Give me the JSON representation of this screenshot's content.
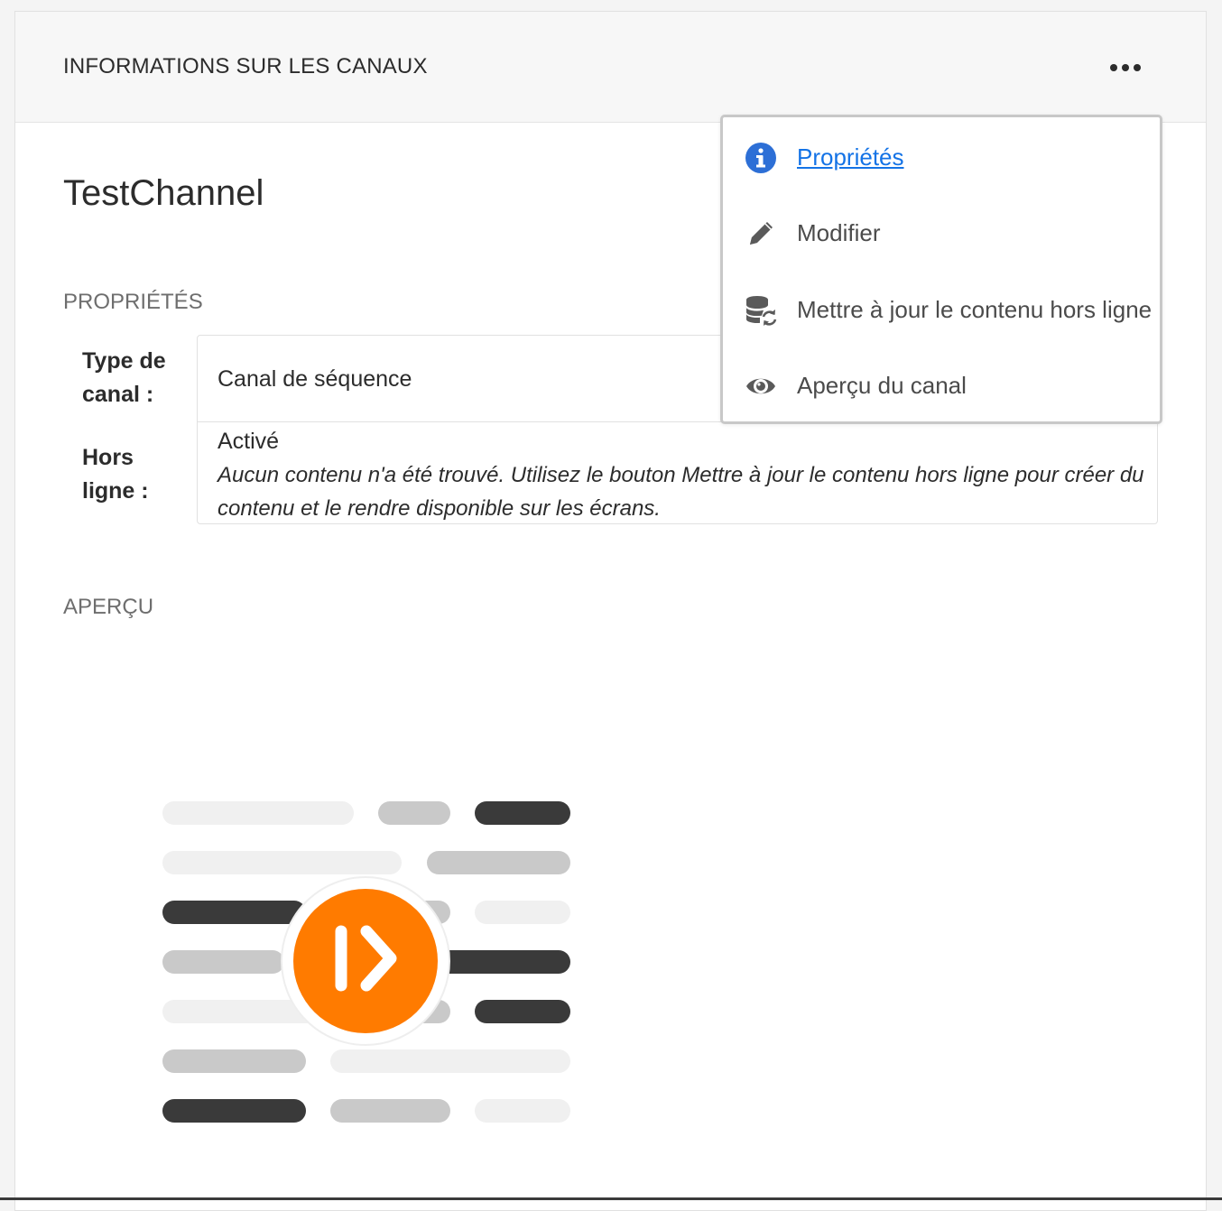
{
  "header": {
    "title": "INFORMATIONS SUR LES CANAUX",
    "more_icon": "more-horizontal-icon"
  },
  "channel": {
    "name": "TestChannel"
  },
  "sections": {
    "properties": "PROPRIÉTÉS",
    "preview": "APERÇU"
  },
  "properties": {
    "type_label_line1": "Type de",
    "type_label_line2": "canal :",
    "type_value": "Canal de séquence",
    "offline_label_line1": "Hors",
    "offline_label_line2": "ligne :",
    "offline_value": "Activé",
    "offline_note": "Aucun contenu n'a été trouvé. Utilisez le bouton Mettre à jour le contenu hors ligne pour créer du contenu et le rendre disponible sur les écrans."
  },
  "menu": {
    "items": [
      {
        "label": "Propriétés",
        "icon": "info-icon"
      },
      {
        "label": "Modifier",
        "icon": "pencil-icon"
      },
      {
        "label": "Mettre à jour le contenu hors ligne",
        "icon": "database-refresh-icon"
      },
      {
        "label": "Aperçu du canal",
        "icon": "eye-icon"
      }
    ]
  },
  "colors": {
    "accent_link": "#1473e6",
    "play_badge": "#ff7b00",
    "info_icon": "#2d6fd6"
  }
}
